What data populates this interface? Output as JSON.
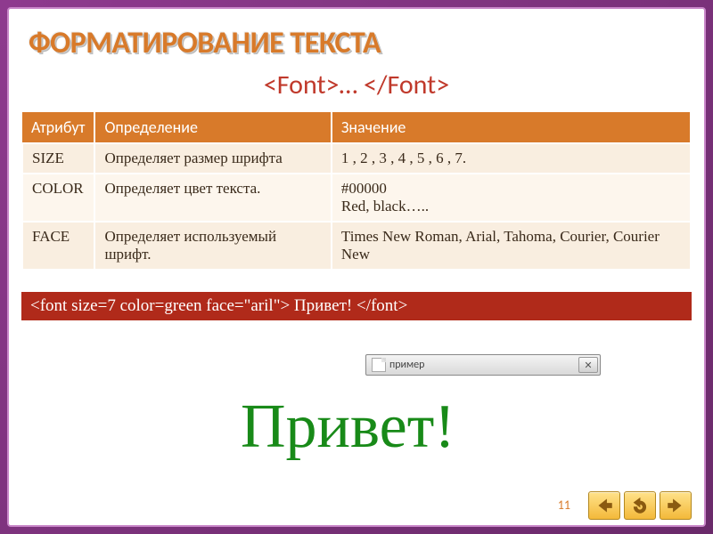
{
  "title": "Форматирование текста",
  "subtitle": "<Font>… </Font>",
  "headers": {
    "h1": "Атрибут",
    "h2": "Определение",
    "h3": "Значение"
  },
  "rows": [
    {
      "attr": "SIZE",
      "def": "Определяет размер шрифта",
      "val": "1 , 2 , 3 , 4 , 5 , 6 , 7."
    },
    {
      "attr": "COLOR",
      "def": "Определяет цвет текста.",
      "val": "#00000\nRed, black….."
    },
    {
      "attr": "FACE",
      "def": "Определяет используемый шрифт.",
      "val": "Times New Roman, Arial, Tahoma, Courier, Courier New"
    }
  ],
  "code_example": "<font size=7 color=green face=\"aril\"> Привет! </font>",
  "browser_tab": "пример",
  "rendered_text": "Привет!",
  "page_number": "11"
}
